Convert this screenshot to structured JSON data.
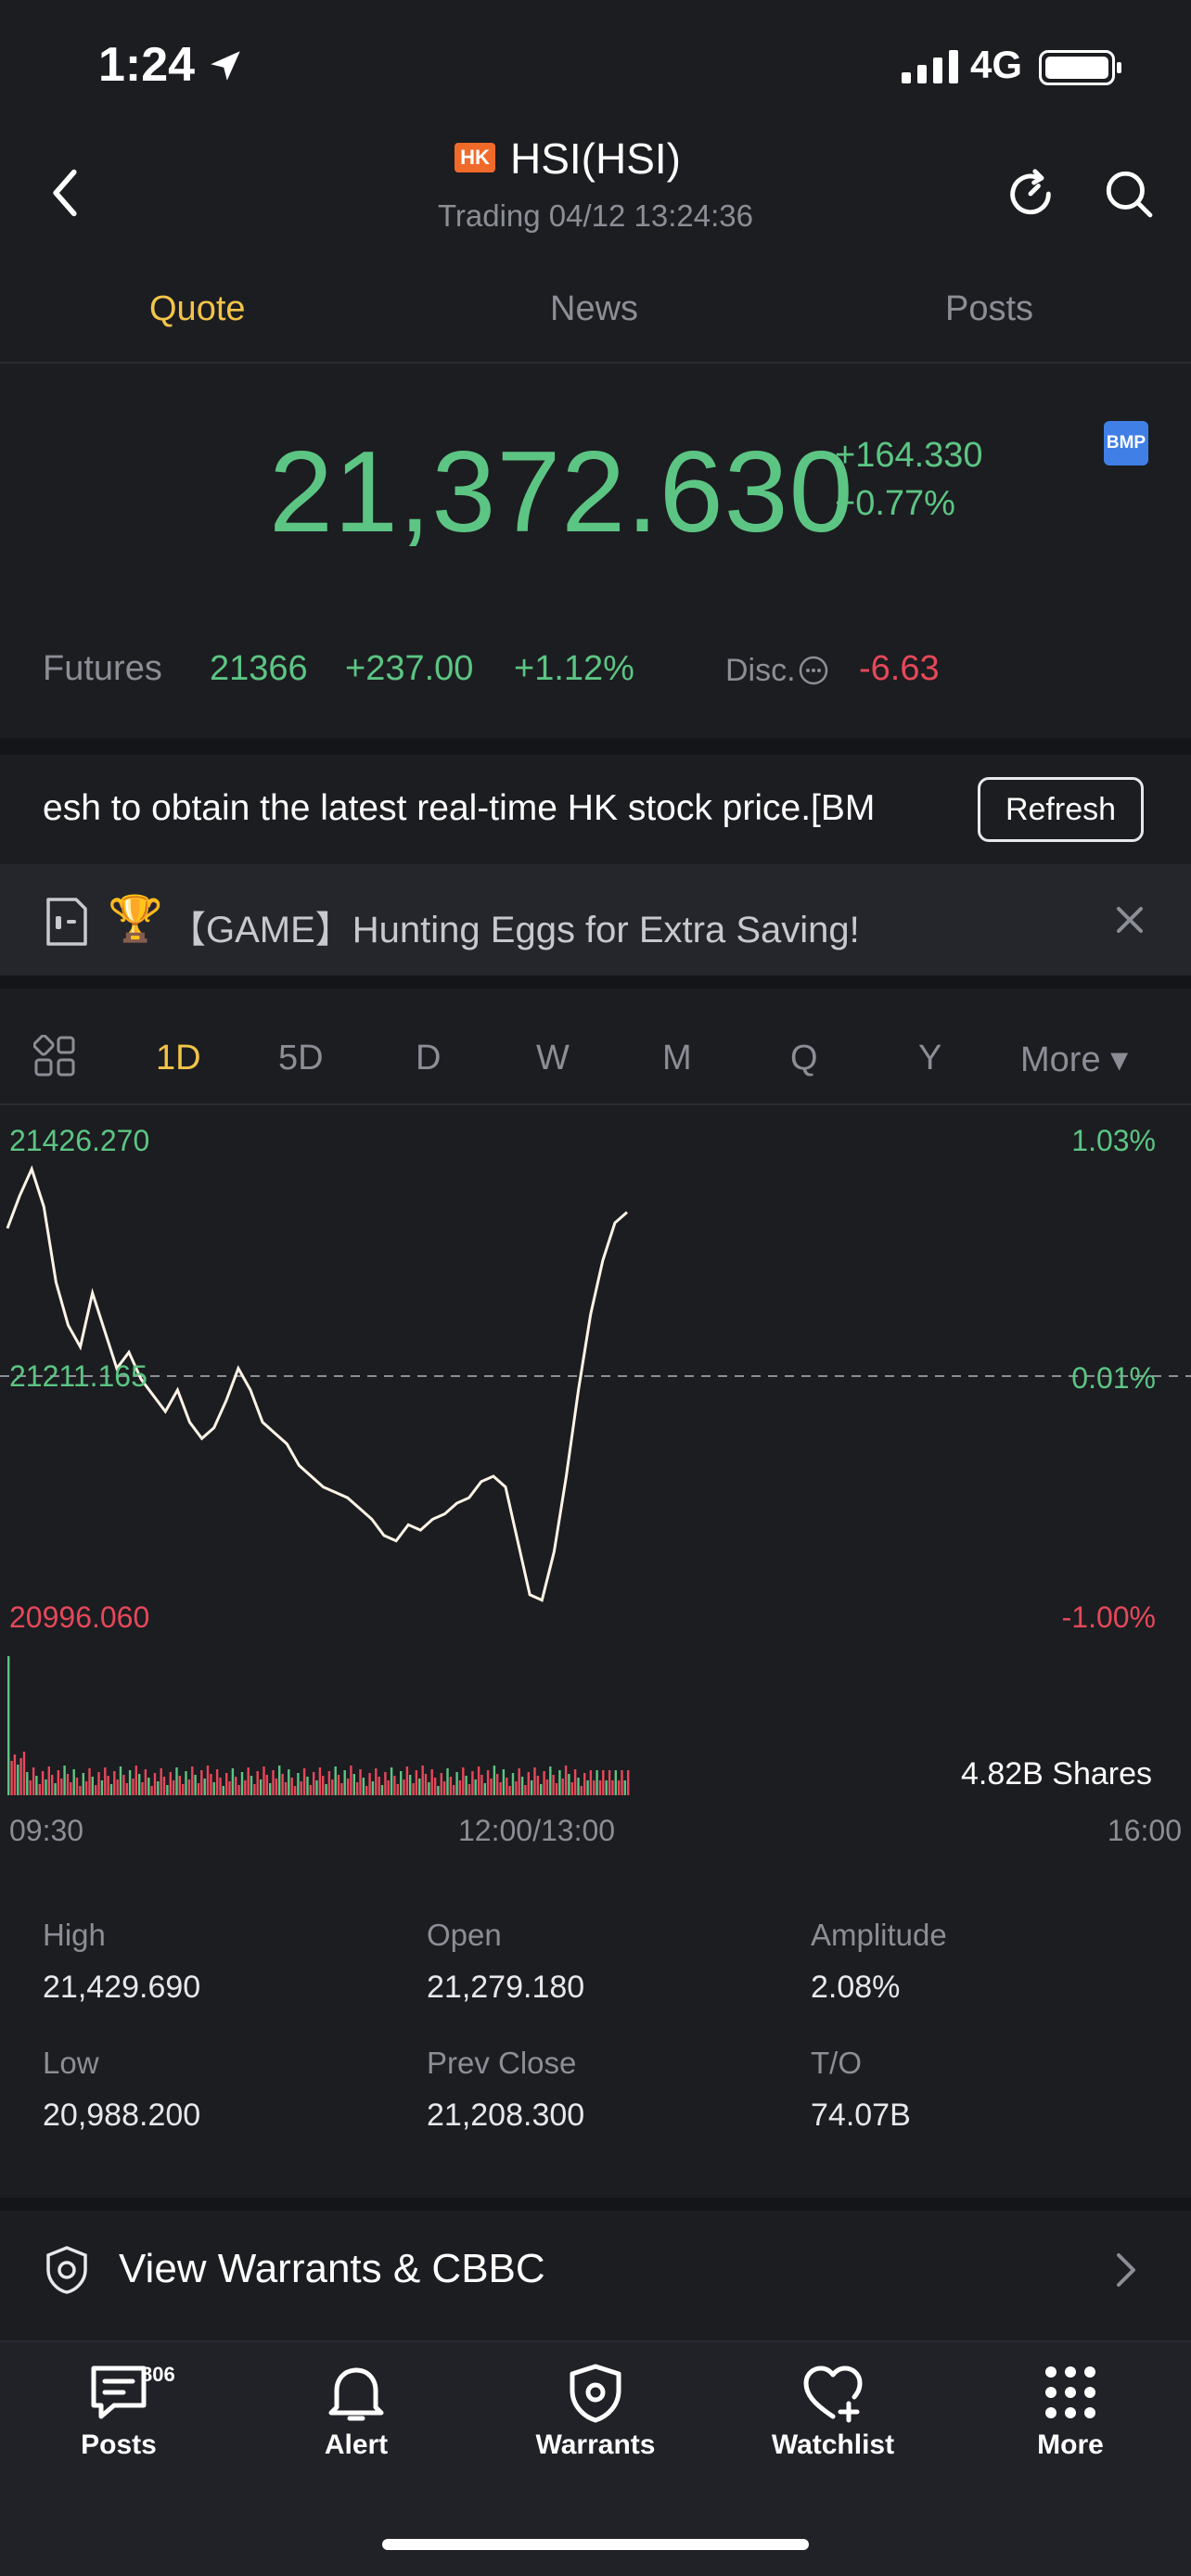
{
  "status_bar": {
    "time": "1:24",
    "network": "4G"
  },
  "header": {
    "market_badge": "HK",
    "ticker": "HSI(HSI)",
    "trading_status": "Trading 04/12 13:24:36"
  },
  "tabs": [
    {
      "label": "Quote",
      "active": true
    },
    {
      "label": "News",
      "active": false
    },
    {
      "label": "Posts",
      "active": false
    }
  ],
  "quote": {
    "price": "21,372.630",
    "change": "+164.330",
    "change_pct": "+0.77%",
    "bmp_badge": "BMP"
  },
  "futures": {
    "label": "Futures",
    "value": "21366",
    "change": "+237.00",
    "change_pct": "+1.12%",
    "disc_label": "Disc.",
    "disc_value": "-6.63"
  },
  "notice": {
    "text": "esh to obtain the latest real-time HK stock price.[BM",
    "refresh_label": "Refresh"
  },
  "promo": {
    "trophy": "🏆",
    "text": "【GAME】Hunting Eggs for Extra Saving!"
  },
  "periods": [
    "1D",
    "5D",
    "D",
    "W",
    "M",
    "Q",
    "Y",
    "More ▾"
  ],
  "active_period": "1D",
  "chart_data": {
    "type": "line",
    "y_high": "21426.270",
    "y_mid": "21211.165",
    "y_low": "20996.060",
    "pct_high": "1.03%",
    "pct_mid": "0.01%",
    "pct_low": "-1.00%",
    "x_labels": [
      "09:30",
      "12:00/13:00",
      "16:00"
    ],
    "volume_label": "4.82B Shares",
    "ylim": [
      20996.06,
      21426.27
    ],
    "prev_close": 21208.3,
    "values": [
      21350,
      21380,
      21405,
      21370,
      21300,
      21260,
      21240,
      21290,
      21255,
      21220,
      21235,
      21210,
      21195,
      21180,
      21200,
      21170,
      21155,
      21165,
      21190,
      21220,
      21200,
      21170,
      21160,
      21150,
      21130,
      21120,
      21110,
      21105,
      21100,
      21090,
      21080,
      21065,
      21060,
      21075,
      21070,
      21080,
      21085,
      21095,
      21100,
      21115,
      21120,
      21110,
      21060,
      21010,
      21005,
      21050,
      21120,
      21200,
      21270,
      21320,
      21355,
      21365
    ]
  },
  "stats": [
    {
      "label": "High",
      "value": "21,429.690"
    },
    {
      "label": "Open",
      "value": "21,279.180"
    },
    {
      "label": "Amplitude",
      "value": "2.08%"
    },
    {
      "label": "Low",
      "value": "20,988.200"
    },
    {
      "label": "Prev Close",
      "value": "21,208.300"
    },
    {
      "label": "T/O",
      "value": "74.07B"
    }
  ],
  "warrants": {
    "label": "View  Warrants & CBBC"
  },
  "bottom_nav": [
    {
      "label": "Posts",
      "badge": "806"
    },
    {
      "label": "Alert"
    },
    {
      "label": "Warrants"
    },
    {
      "label": "Watchlist"
    },
    {
      "label": "More"
    }
  ],
  "colors": {
    "up": "#5cc583",
    "down": "#e6485a",
    "accent": "#f2c448",
    "bg": "#1c1d21"
  }
}
